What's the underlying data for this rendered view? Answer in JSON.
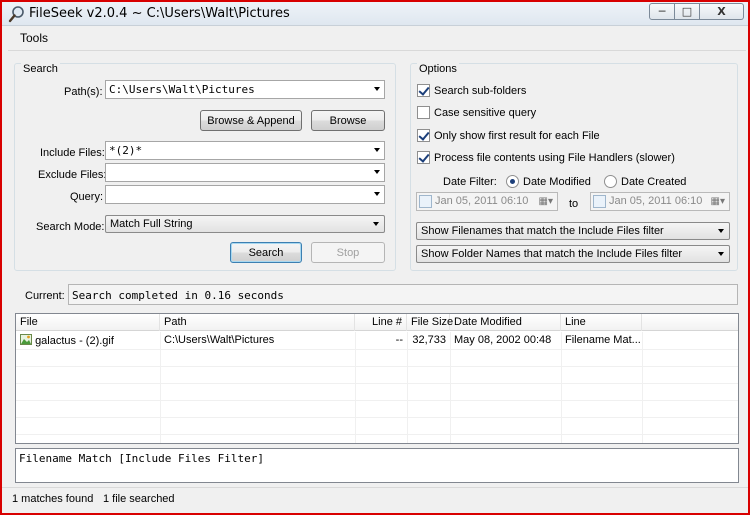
{
  "window": {
    "title": "FileSeek v2.0.4 ~ C:\\Users\\Walt\\Pictures",
    "buttons": {
      "minimize": "─",
      "maximize": "□",
      "close": "X"
    }
  },
  "menu": {
    "tools": "Tools"
  },
  "search": {
    "group_title": "Search",
    "paths_label": "Path(s):",
    "paths_value": "C:\\Users\\Walt\\Pictures",
    "browse_append_label": "Browse & Append",
    "browse_label": "Browse",
    "include_label": "Include Files:",
    "include_value": "*(2)*",
    "exclude_label": "Exclude Files:",
    "exclude_value": "",
    "query_label": "Query:",
    "query_value": "",
    "mode_label": "Search Mode:",
    "mode_value": "Match Full String",
    "search_button": "Search",
    "stop_button": "Stop"
  },
  "options": {
    "group_title": "Options",
    "checks": [
      {
        "label": "Search sub-folders",
        "checked": true
      },
      {
        "label": "Case sensitive query",
        "checked": false
      },
      {
        "label": "Only show first result for each File",
        "checked": true
      },
      {
        "label": "Process file contents using File Handlers (slower)",
        "checked": true
      }
    ],
    "date_filter_label": "Date Filter:",
    "date_modified_label": "Date Modified",
    "date_created_label": "Date Created",
    "date_from": "Jan 05, 2011 06:10",
    "to_label": "to",
    "date_to": "Jan 05, 2011 06:10",
    "filename_filter": "Show Filenames that match the Include Files filter",
    "folder_filter": "Show Folder Names that match the Include Files filter"
  },
  "current": {
    "label": "Current:",
    "value": "Search completed in 0.16 seconds"
  },
  "results": {
    "columns": [
      "File",
      "Path",
      "Line #",
      "File Size",
      "Date Modified",
      "Line"
    ],
    "rows": [
      {
        "file": "galactus - (2).gif",
        "path": "C:\\Users\\Walt\\Pictures",
        "line_no": "--",
        "size": "32,733",
        "modified": "May 08, 2002 00:48",
        "line": "Filename Mat..."
      }
    ]
  },
  "detail": {
    "value": "Filename Match [Include Files Filter]"
  },
  "status": {
    "matches": "1 matches found",
    "searched": "1 file searched"
  }
}
